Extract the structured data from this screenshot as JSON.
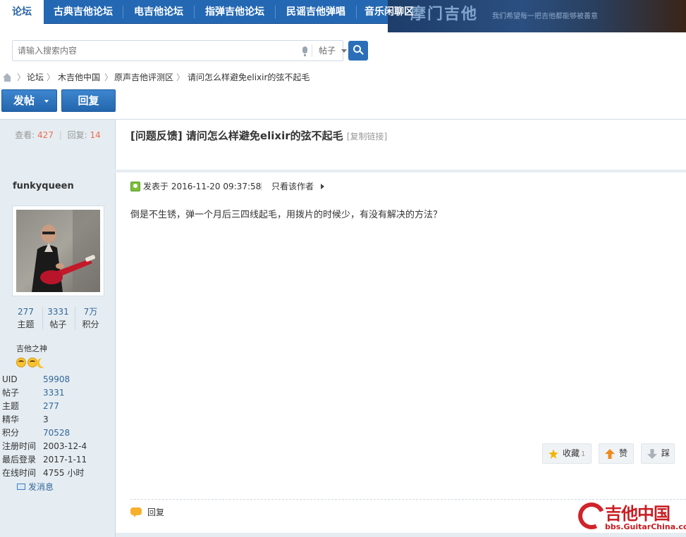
{
  "nav": {
    "tabs": [
      "论坛",
      "古典吉他论坛",
      "电吉他论坛",
      "指弹吉他论坛",
      "民谣吉他弹唱",
      "音乐闲聊区"
    ]
  },
  "banner": {
    "title": "摩门吉他",
    "subtitle": "我们希望每一把吉他都能够被善意"
  },
  "search": {
    "placeholder": "请输入搜索内容",
    "type": "帖子"
  },
  "breadcrumb": [
    "论坛",
    "木吉他中国",
    "原声吉他评测区",
    "请问怎么样避免elixir的弦不起毛"
  ],
  "buttons": {
    "post": "发帖",
    "reply": "回复"
  },
  "thread": {
    "views_label": "查看:",
    "views": "427",
    "replies_label": "回复:",
    "replies": "14",
    "title": "[问题反馈] 请问怎么样避免elixir的弦不起毛",
    "copy_link": "[复制链接]"
  },
  "author": {
    "name": "funkyqueen",
    "threads": "277",
    "threads_label": "主题",
    "posts": "3331",
    "posts_label": "帖子",
    "points": "7万",
    "points_label": "积分",
    "rank": "吉他之神",
    "info": [
      {
        "k": "UID",
        "v": "59908"
      },
      {
        "k": "帖子",
        "v": "3331"
      },
      {
        "k": "主题",
        "v": "277"
      },
      {
        "k": "精华",
        "v": "3"
      },
      {
        "k": "积分",
        "v": "70528"
      },
      {
        "k": "注册时间",
        "v": "2003-12-4"
      },
      {
        "k": "最后登录",
        "v": "2017-1-11"
      },
      {
        "k": "在线时间",
        "v": "4755 小时"
      }
    ],
    "message": "发消息"
  },
  "post": {
    "posted": "发表于 2016-11-20 09:37:58",
    "only_author": "只看该作者",
    "body": "倒是不生锈，弹一个月后三四线起毛，用拨片的时候少，有没有解决的方法？",
    "favorite": "收藏",
    "favorite_count": "1",
    "like": "赞",
    "dislike": "踩",
    "reply": "回复"
  },
  "watermark": {
    "title": "吉他中国",
    "url": "bbs.GuitarChina.com"
  },
  "colors": {
    "nav_bg": "#2468b3",
    "link": "#336699",
    "count": "#f26c4f",
    "sidebar_bg": "#e5edf2"
  }
}
